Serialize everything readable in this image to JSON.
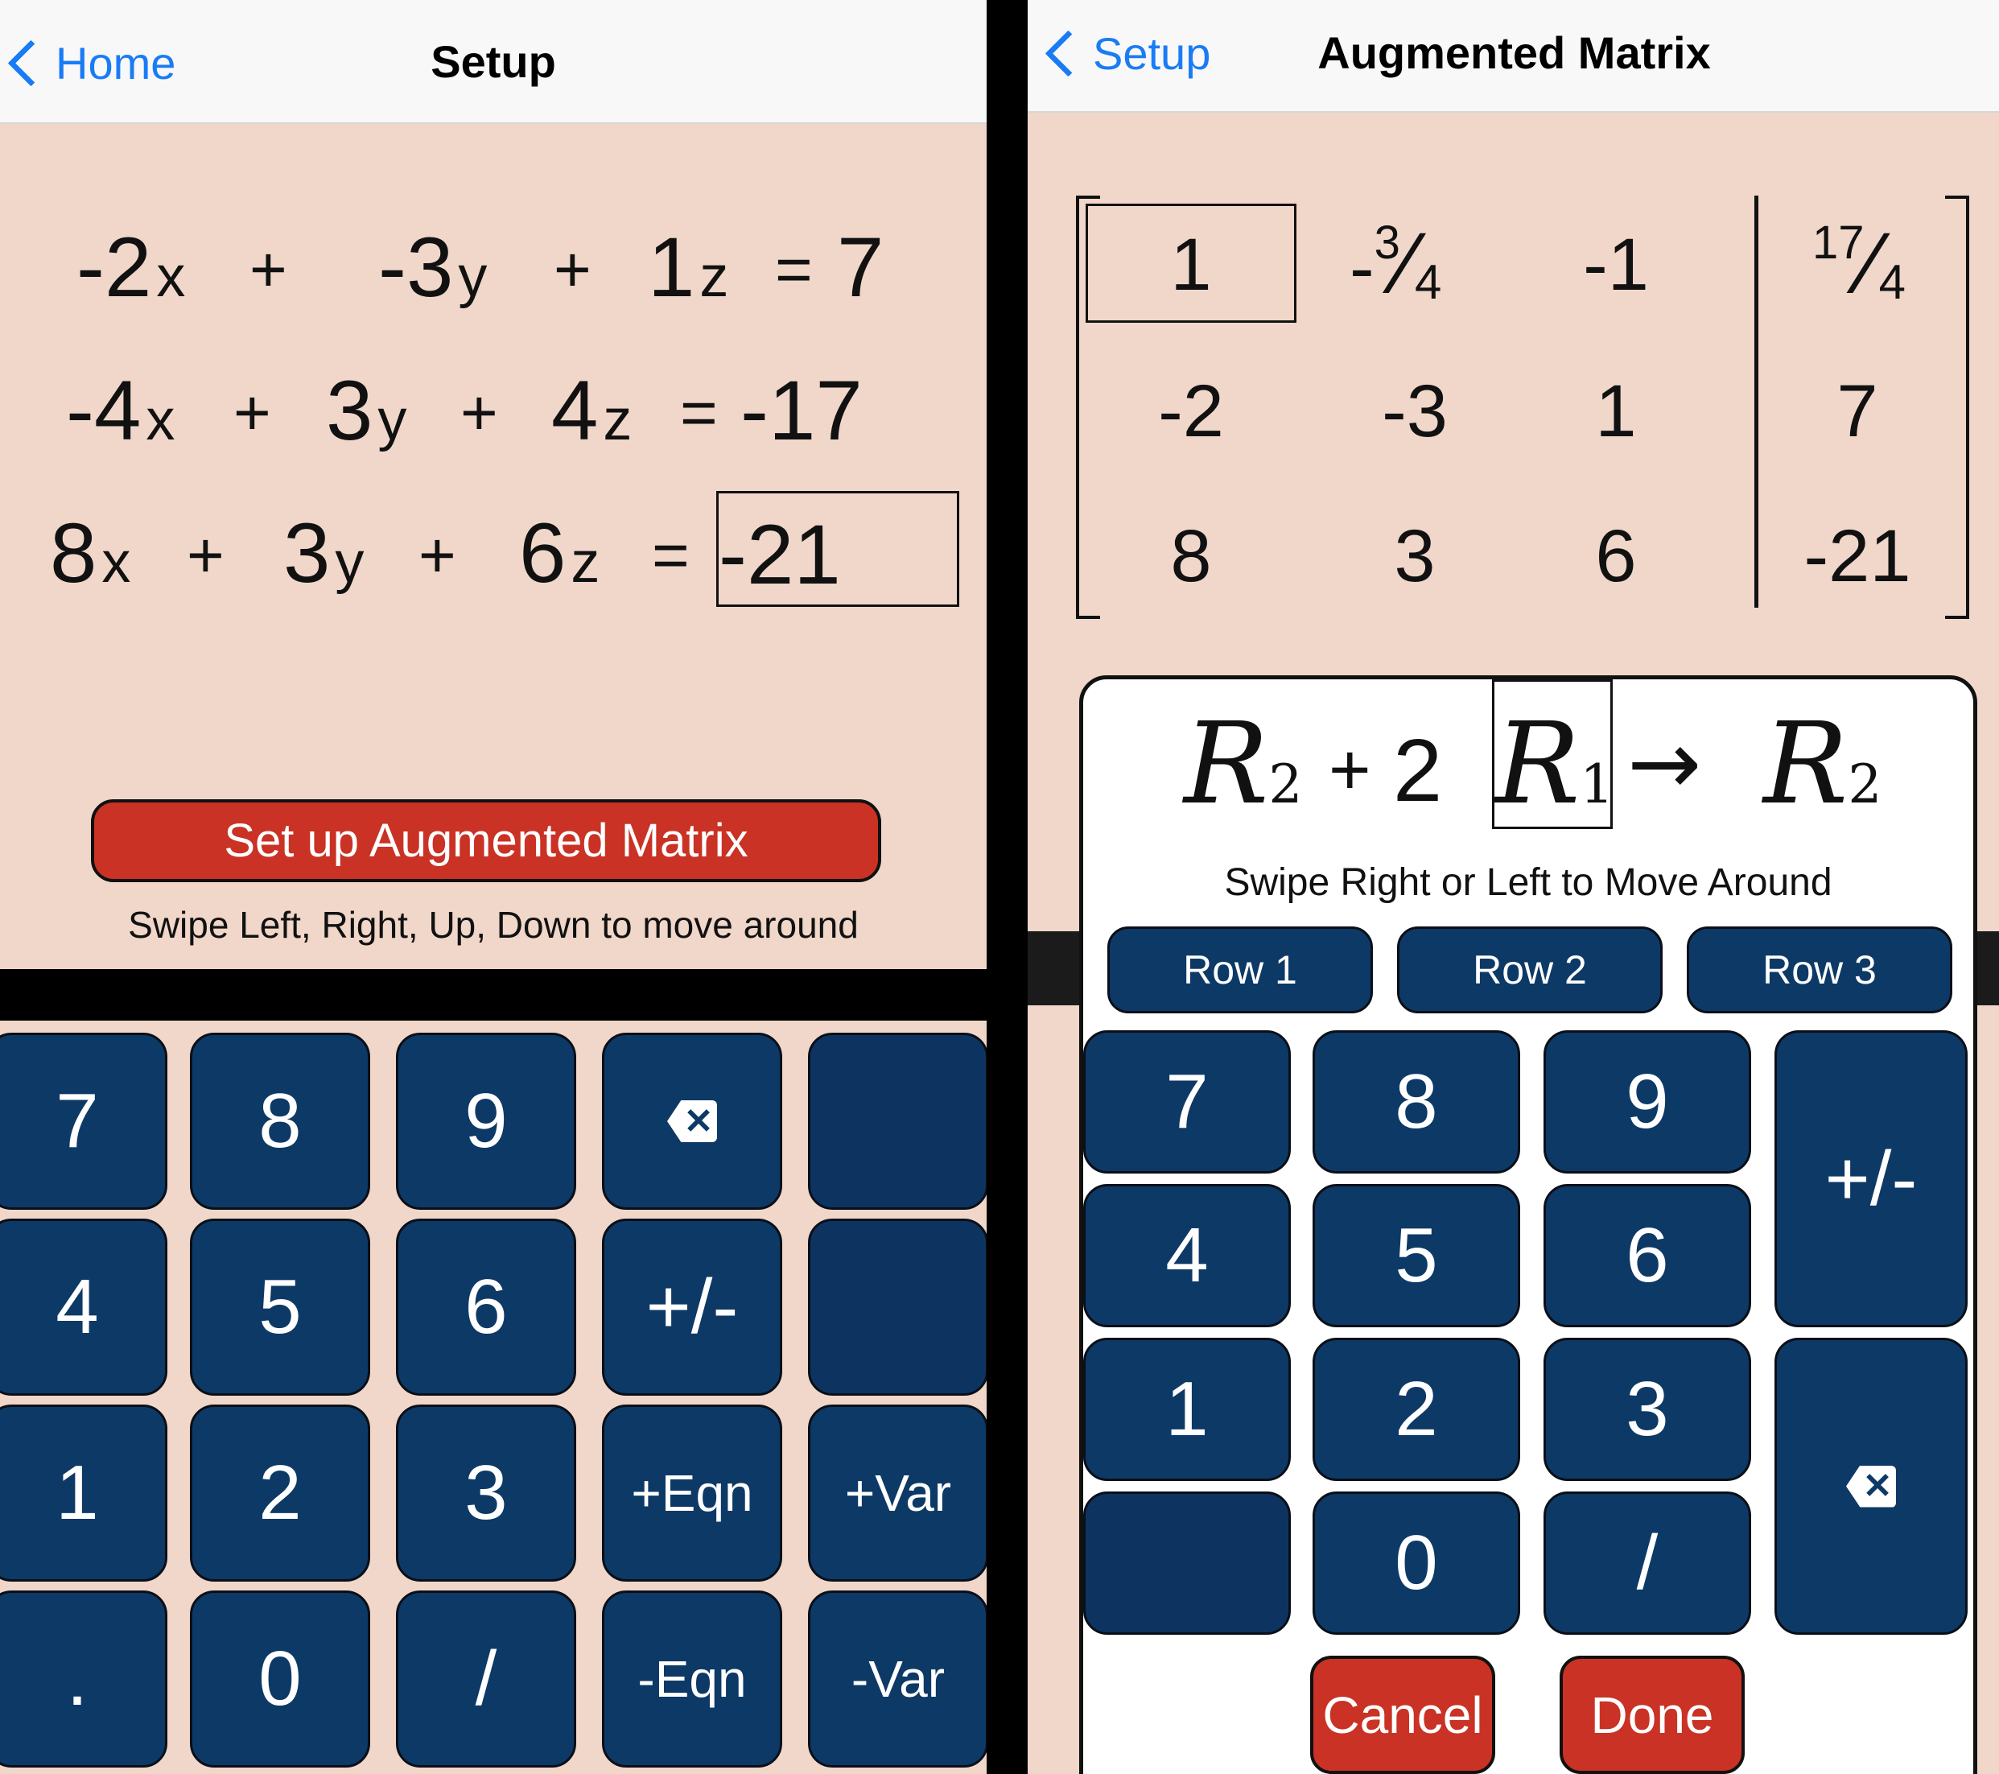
{
  "left": {
    "nav": {
      "back_label": "Home",
      "title": "Setup"
    },
    "equations": [
      {
        "terms": [
          {
            "coef": "-2",
            "var": "x"
          },
          {
            "coef": "-3",
            "var": "y"
          },
          {
            "coef": "1",
            "var": "z"
          }
        ],
        "plus": [
          "+",
          "+"
        ],
        "eq": "=",
        "rhs": "7"
      },
      {
        "terms": [
          {
            "coef": "-4",
            "var": "x"
          },
          {
            "coef": "3",
            "var": "y"
          },
          {
            "coef": "4",
            "var": "z"
          }
        ],
        "plus": [
          "+",
          "+"
        ],
        "eq": "=",
        "rhs": "-17"
      },
      {
        "terms": [
          {
            "coef": "8",
            "var": "x"
          },
          {
            "coef": "3",
            "var": "y"
          },
          {
            "coef": "6",
            "var": "z"
          }
        ],
        "plus": [
          "+",
          "+"
        ],
        "eq": "=",
        "rhs": "-21"
      }
    ],
    "setup_button": "Set up Augmented Matrix",
    "hint": "Swipe Left, Right, Up, Down to move around",
    "keypad": [
      [
        "7",
        "8",
        "9",
        "backspace",
        ""
      ],
      [
        "4",
        "5",
        "6",
        "+/-",
        ""
      ],
      [
        "1",
        "2",
        "3",
        "+Eqn",
        "+Var"
      ],
      [
        ".",
        "0",
        "/",
        "-Eqn",
        "-Var"
      ]
    ]
  },
  "right": {
    "nav": {
      "back_label": "Setup",
      "title": "Augmented Matrix"
    },
    "matrix": [
      [
        {
          "text": "1"
        },
        {
          "sign": "-",
          "num": "3",
          "den": "4"
        },
        {
          "text": "-1"
        },
        {
          "num": "17",
          "den": "4"
        }
      ],
      [
        {
          "text": "-2"
        },
        {
          "text": "-3"
        },
        {
          "text": "1"
        },
        {
          "text": "7"
        }
      ],
      [
        {
          "text": "8"
        },
        {
          "text": "3"
        },
        {
          "text": "6"
        },
        {
          "text": "-21"
        }
      ]
    ],
    "row_op": {
      "target": "R",
      "target_sub": "2",
      "plus": "+",
      "scalar": "2",
      "source": "R",
      "source_sub": "1",
      "arrow": "→",
      "result": "R",
      "result_sub": "2"
    },
    "hint": "Swipe Right or Left to Move Around",
    "row_buttons": [
      "Row 1",
      "Row 2",
      "Row 3"
    ],
    "keypad": {
      "digits": [
        [
          "7",
          "8",
          "9"
        ],
        [
          "4",
          "5",
          "6"
        ],
        [
          "1",
          "2",
          "3"
        ],
        [
          "",
          "0",
          "/"
        ]
      ],
      "plus_minus": "+/-",
      "backspace": "backspace"
    },
    "cancel": "Cancel",
    "done": "Done"
  },
  "colors": {
    "background": "#f0d7ca",
    "key": "#0d3966",
    "accent_red": "#c93224",
    "link_blue": "#1a7cf5"
  }
}
